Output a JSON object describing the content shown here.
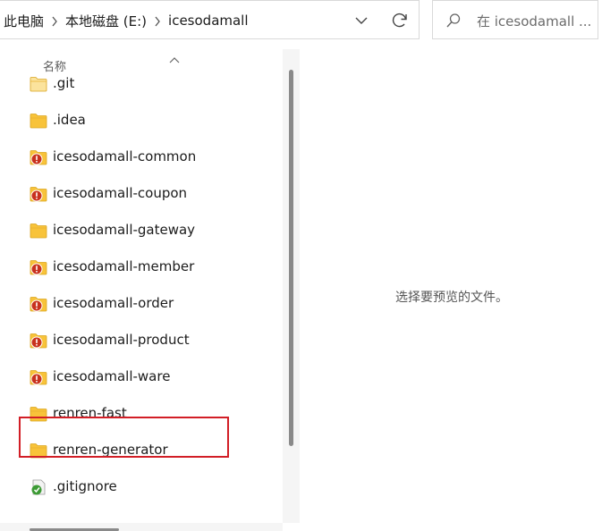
{
  "breadcrumb": {
    "items": [
      "此电脑",
      "本地磁盘 (E:)",
      "icesodamall"
    ]
  },
  "search": {
    "placeholder": "在 icesodamall ..."
  },
  "list": {
    "column_header": "名称",
    "items": [
      {
        "name": ".git",
        "type": "folder-light"
      },
      {
        "name": ".idea",
        "type": "folder"
      },
      {
        "name": "icesodamall-common",
        "type": "folder-error"
      },
      {
        "name": "icesodamall-coupon",
        "type": "folder-error"
      },
      {
        "name": "icesodamall-gateway",
        "type": "folder"
      },
      {
        "name": "icesodamall-member",
        "type": "folder-error"
      },
      {
        "name": "icesodamall-order",
        "type": "folder-error"
      },
      {
        "name": "icesodamall-product",
        "type": "folder-error"
      },
      {
        "name": "icesodamall-ware",
        "type": "folder-error"
      },
      {
        "name": "renren-fast",
        "type": "folder"
      },
      {
        "name": "renren-generator",
        "type": "folder"
      },
      {
        "name": ".gitignore",
        "type": "file-gitignore"
      }
    ]
  },
  "preview": {
    "message": "选择要预览的文件。"
  },
  "colors": {
    "folder": "#f8c33a",
    "folder_light": "#fbe39d",
    "error_badge": "#c8321e",
    "highlight": "#d21e26"
  }
}
